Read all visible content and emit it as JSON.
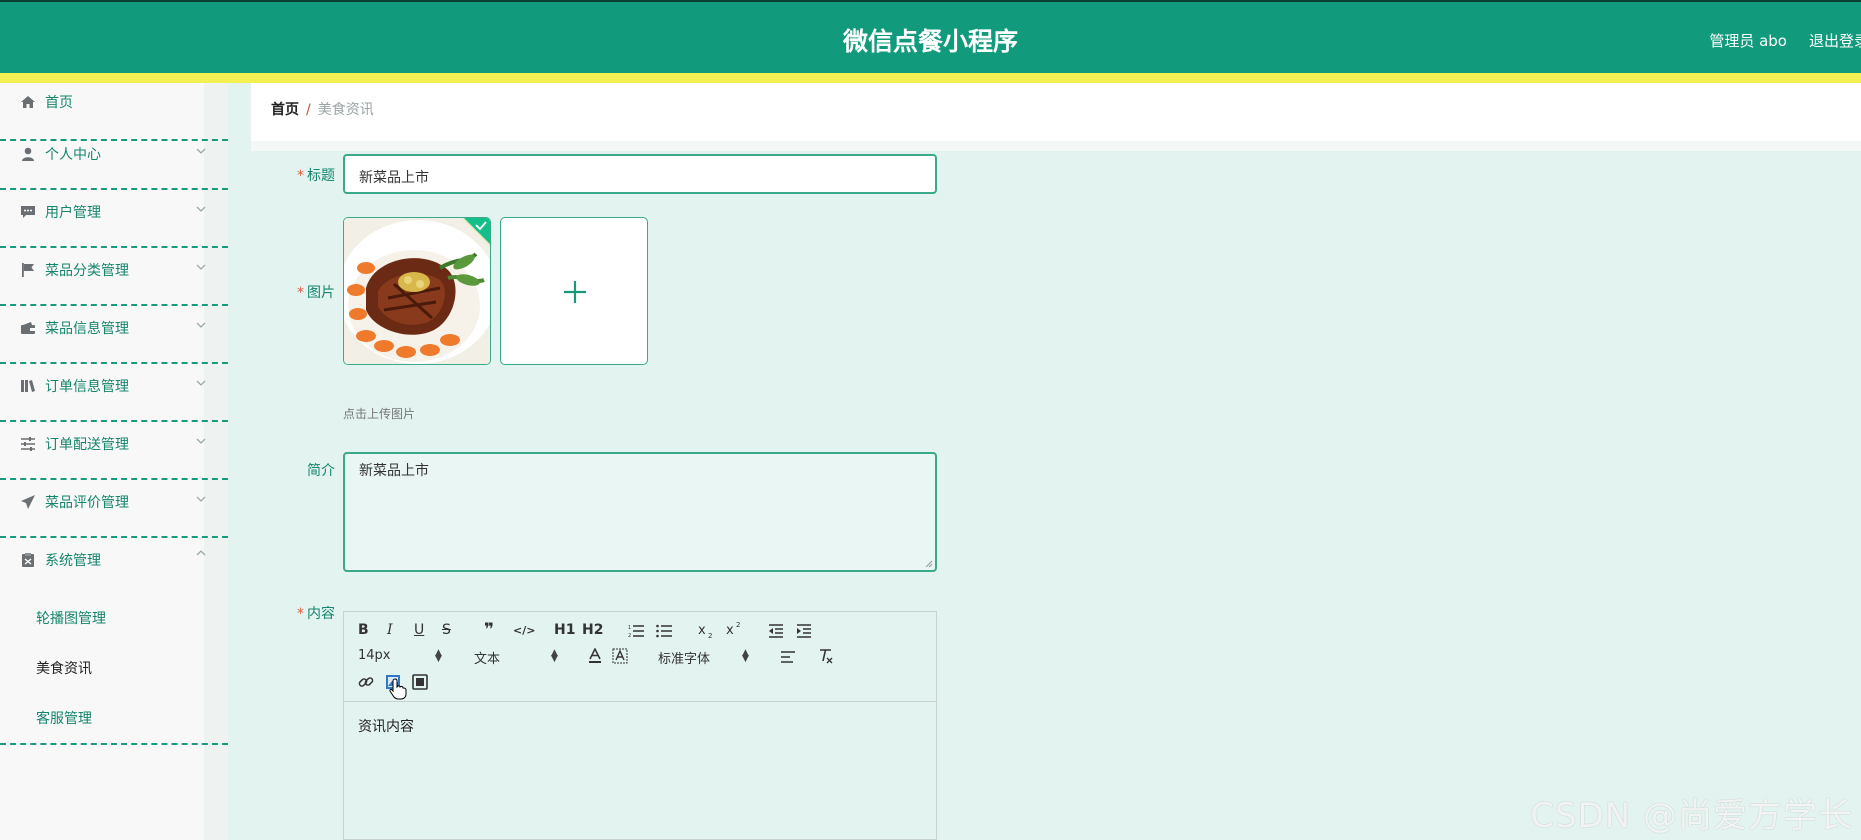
{
  "header": {
    "app_title": "微信点餐小程序",
    "user_label": "管理员 abo",
    "logout_label": "退出登录"
  },
  "sidebar": {
    "items": [
      {
        "label": "首页",
        "icon": "home-icon"
      },
      {
        "label": "个人中心",
        "icon": "user-icon"
      },
      {
        "label": "用户管理",
        "icon": "chat-icon"
      },
      {
        "label": "菜品分类管理",
        "icon": "flag-icon"
      },
      {
        "label": "菜品信息管理",
        "icon": "wallet-icon"
      },
      {
        "label": "订单信息管理",
        "icon": "books-icon"
      },
      {
        "label": "订单配送管理",
        "icon": "sliders-icon"
      },
      {
        "label": "菜品评价管理",
        "icon": "send-icon"
      },
      {
        "label": "系统管理",
        "icon": "clipboard-icon"
      }
    ],
    "submenu": [
      {
        "label": "轮播图管理"
      },
      {
        "label": "美食资讯"
      },
      {
        "label": "客服管理"
      }
    ]
  },
  "breadcrumb": {
    "home": "首页",
    "separator": "/",
    "current": "美食资讯"
  },
  "form": {
    "title_label": "标题",
    "title_value": "新菜品上市",
    "image_label": "图片",
    "upload_hint": "点击上传图片",
    "intro_label": "简介",
    "intro_value": "新菜品上市",
    "content_label": "内容",
    "content_value": "资讯内容",
    "required_mark": "*"
  },
  "editor_toolbar": {
    "bold": "B",
    "italic": "I",
    "underline": "U",
    "strike": "S",
    "quote": "❞",
    "code": "</>",
    "h1": "H1",
    "h2": "H2",
    "font_size": "14px",
    "block_type": "文本",
    "font_family": "标准字体"
  },
  "watermark": "CSDN @尚爱方学长",
  "colors": {
    "header": "#119a7c",
    "accent_yellow": "#f4f051",
    "content_bg": "#e3f3ef",
    "required": "#e15b40"
  }
}
